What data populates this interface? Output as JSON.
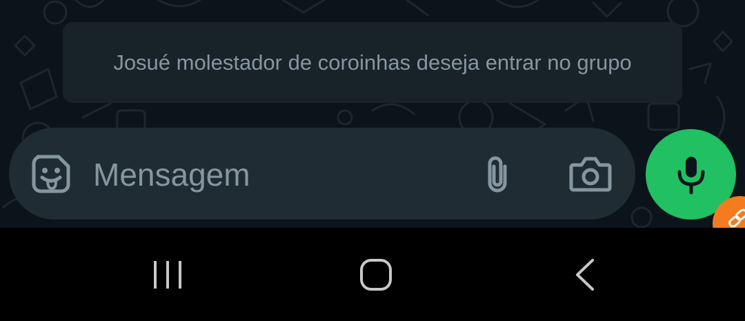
{
  "system_message": {
    "text": "Josué molestador de coroinhas deseja entrar no grupo"
  },
  "composer": {
    "placeholder": "Mensagem",
    "icons": {
      "emoji": "sticker-emoji-icon",
      "attach": "paperclip-icon",
      "camera": "camera-icon"
    }
  },
  "mic_button": {
    "icon": "microphone-icon"
  },
  "overlay_badge": {
    "icon": "link-icon"
  },
  "navigation": {
    "buttons": [
      "recents-icon",
      "home-icon",
      "back-icon"
    ]
  },
  "colors": {
    "chat_background": "#0b141a",
    "bubble_background": "#182229",
    "composer_background": "#1f2c34",
    "secondary_text": "#8696a0",
    "accent_green": "#21c063",
    "nav_background": "#000000",
    "overlay_orange": "#f47b20"
  }
}
